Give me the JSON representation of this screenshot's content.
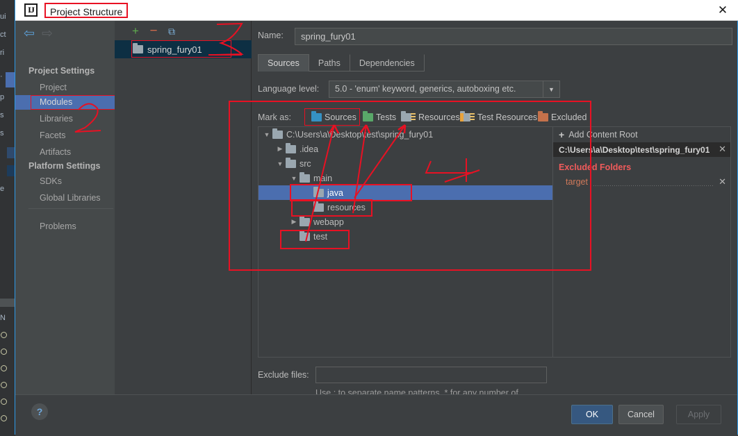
{
  "window": {
    "title": "Project Structure",
    "logo_text": "IJ",
    "close_label": "✕"
  },
  "sidebar": {
    "nav_back_icon": "⇦",
    "nav_forward_icon": "⇨",
    "groups": [
      {
        "title": "Project Settings",
        "items": [
          {
            "label": "Project",
            "selected": false
          },
          {
            "label": "Modules",
            "selected": true
          },
          {
            "label": "Libraries",
            "selected": false
          },
          {
            "label": "Facets",
            "selected": false
          },
          {
            "label": "Artifacts",
            "selected": false
          }
        ]
      },
      {
        "title": "Platform Settings",
        "items": [
          {
            "label": "SDKs",
            "selected": false
          },
          {
            "label": "Global Libraries",
            "selected": false
          }
        ]
      }
    ],
    "problems_label": "Problems"
  },
  "module_list": {
    "toolbar": {
      "add_label": "+",
      "remove_label": "−",
      "copy_label": "⧉"
    },
    "modules": [
      {
        "label": "spring_fury01",
        "selected": true
      }
    ]
  },
  "content": {
    "name_label": "Name:",
    "name_value": "spring_fury01",
    "tabs": [
      {
        "label": "Sources",
        "active": true
      },
      {
        "label": "Paths",
        "active": false
      },
      {
        "label": "Dependencies",
        "active": false
      }
    ],
    "language_level_label": "Language level:",
    "language_level_value": "5.0 - 'enum' keyword, generics, autoboxing etc.",
    "language_level_arrow": "▼",
    "mark_as_label": "Mark as:",
    "mark_as_buttons": [
      {
        "label": "Sources",
        "mnemonic": "S",
        "icon": "folder-blue-icon",
        "color": "#3592c4"
      },
      {
        "label": "Tests",
        "mnemonic": "T",
        "icon": "folder-green-icon",
        "color": "#59a869"
      },
      {
        "label": "Resources",
        "mnemonic": "R",
        "icon": "folder-resources-icon",
        "color": "#9aa7b0"
      },
      {
        "label": "Test Resources",
        "mnemonic": "",
        "icon": "folder-test-resources-icon",
        "color": "#e8a33d"
      },
      {
        "label": "Excluded",
        "mnemonic": "E",
        "icon": "folder-orange-icon",
        "color": "#c4714b"
      }
    ],
    "tree": [
      {
        "label": "C:\\Users\\a\\Desktop\\test\\spring_fury01",
        "depth": 0,
        "twisty": "▼",
        "selected": false
      },
      {
        "label": ".idea",
        "depth": 1,
        "twisty": "▶",
        "selected": false
      },
      {
        "label": "src",
        "depth": 1,
        "twisty": "▼",
        "selected": false
      },
      {
        "label": "main",
        "depth": 2,
        "twisty": "▼",
        "selected": false
      },
      {
        "label": "java",
        "depth": 3,
        "twisty": "",
        "selected": true
      },
      {
        "label": "resources",
        "depth": 3,
        "twisty": "",
        "selected": false
      },
      {
        "label": "webapp",
        "depth": 2,
        "twisty": "▶",
        "selected": false
      },
      {
        "label": "test",
        "depth": 2,
        "twisty": "",
        "selected": false
      }
    ],
    "roots_panel": {
      "add_content_root_label": "Add Content Root",
      "add_icon": "+",
      "content_root": "C:\\Users\\a\\Desktop\\test\\spring_fury01",
      "content_root_remove": "✕",
      "excluded_folders_title": "Excluded Folders",
      "excluded_folders": [
        {
          "label": "target",
          "remove": "✕"
        }
      ]
    },
    "exclude_files_label": "Exclude files:",
    "exclude_files_value": "",
    "exclude_files_hint": "Use ; to separate name patterns, * for any number of symbols, ? for one."
  },
  "footer": {
    "help_label": "?",
    "ok_label": "OK",
    "cancel_label": "Cancel",
    "apply_label": "Apply"
  },
  "annotation_color": "#e81123"
}
